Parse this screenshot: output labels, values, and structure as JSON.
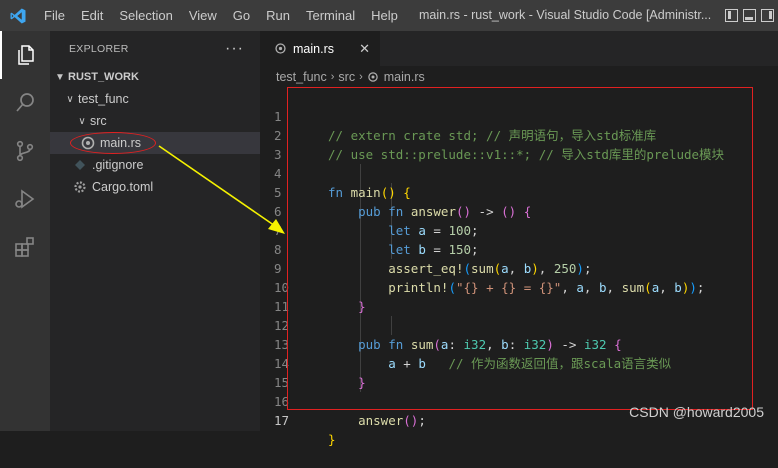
{
  "titlebar": {
    "menu": [
      "File",
      "Edit",
      "Selection",
      "View",
      "Go",
      "Run",
      "Terminal",
      "Help"
    ],
    "window_title": "main.rs - rust_work - Visual Studio Code [Administr..."
  },
  "sidebar": {
    "header": "EXPLORER",
    "more": "···",
    "tree": {
      "root": "RUST_WORK",
      "folder": "test_func",
      "subfolder": "src",
      "selected_file": "main.rs",
      "files": [
        ".gitignore",
        "Cargo.toml"
      ]
    }
  },
  "tab": {
    "label": "main.rs",
    "close": "✕"
  },
  "breadcrumb": [
    "test_func",
    "src",
    "main.rs"
  ],
  "editor": {
    "line_numbers": [
      "1",
      "2",
      "3",
      "4",
      "5",
      "6",
      "7",
      "8",
      "9",
      "10",
      "11",
      "12",
      "13",
      "14",
      "15",
      "16",
      "17"
    ],
    "current_line": 17,
    "lines": [
      "// extern crate std; // 声明语句，导入std标准库",
      "// use std::prelude::v1::*; // 导入std库里的prelude模块",
      "",
      "fn main() {",
      "    pub fn answer() -> () {",
      "        let a = 100;",
      "        let b = 150;",
      "        assert_eq!(sum(a, b), 250);",
      "        println!(\"{} + {} = {}\", a, b, sum(a, b));",
      "    }",
      "",
      "    pub fn sum(a: i32, b: i32) -> i32 {",
      "        a + b   // 作为函数返回值，跟scala语言类似",
      "    }",
      "",
      "    answer();",
      "}"
    ]
  },
  "watermark": "CSDN @howard2005",
  "colors": {
    "annotation_red": "#e12121",
    "annotation_arrow": "#f5f200",
    "accent_blue": "#007acc"
  }
}
